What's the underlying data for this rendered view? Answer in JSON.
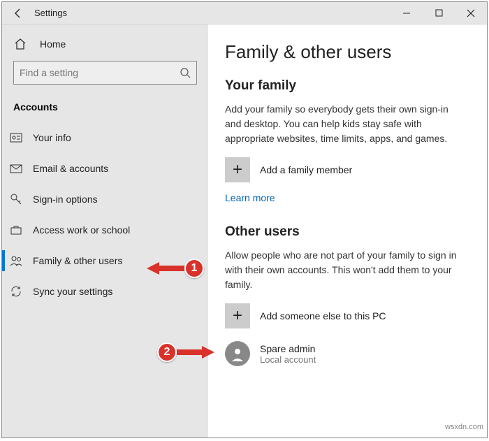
{
  "window_title": "Settings",
  "sidebar": {
    "home": "Home",
    "search_placeholder": "Find a setting",
    "section": "Accounts",
    "items": [
      {
        "label": "Your info"
      },
      {
        "label": "Email & accounts"
      },
      {
        "label": "Sign-in options"
      },
      {
        "label": "Access work or school"
      },
      {
        "label": "Family & other users"
      },
      {
        "label": "Sync your settings"
      }
    ]
  },
  "main": {
    "heading": "Family & other users",
    "family_heading": "Your family",
    "family_desc": "Add your family so everybody gets their own sign-in and desktop. You can help kids stay safe with appropriate websites, time limits, apps, and games.",
    "add_family": "Add a family member",
    "learn_more": "Learn more",
    "other_heading": "Other users",
    "other_desc": "Allow people who are not part of your family to sign in with their own accounts. This won't add them to your family.",
    "add_other": "Add someone else to this PC",
    "user_name": "Spare admin",
    "user_type": "Local account"
  },
  "annotations": {
    "one": "1",
    "two": "2"
  },
  "watermark": "wsxdn.com"
}
